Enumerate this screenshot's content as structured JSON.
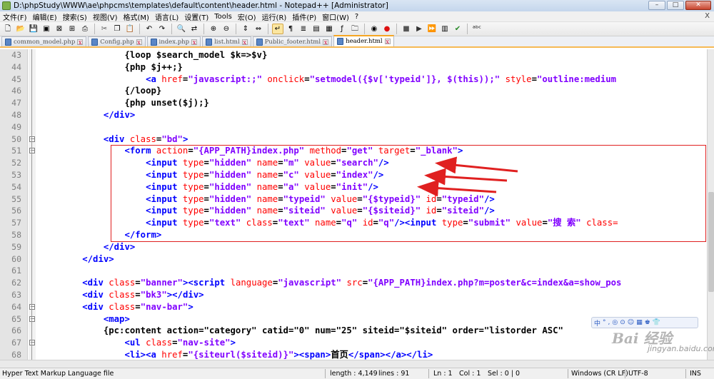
{
  "window": {
    "title": "D:\\phpStudy\\WWW\\ae\\phpcms\\templates\\default\\content\\header.html - Notepad++ [Administrator]",
    "minimize": "–",
    "maximize": "□",
    "close": "✕"
  },
  "menu": [
    "文件(F)",
    "编辑(E)",
    "搜索(S)",
    "视图(V)",
    "格式(M)",
    "语言(L)",
    "设置(T)",
    "Tools",
    "宏(O)",
    "运行(R)",
    "插件(P)",
    "窗口(W)",
    "?"
  ],
  "menu_close": "X",
  "tabs": [
    {
      "label": "common_model.php"
    },
    {
      "label": "Config.php"
    },
    {
      "label": "index.php"
    },
    {
      "label": "list.html"
    },
    {
      "label": "Public_footer.html"
    },
    {
      "label": "header.html",
      "active": true
    }
  ],
  "editor": {
    "lines": [
      {
        "n": "43",
        "tokens": [
          [
            "d",
            "                {loop $search_model $k=>$v}"
          ]
        ]
      },
      {
        "n": "44",
        "tokens": [
          [
            "d",
            "                {php $j++;}"
          ]
        ]
      },
      {
        "n": "45",
        "tokens": [
          [
            "d",
            "                    "
          ],
          [
            "tag",
            "<a "
          ],
          [
            "attr",
            "href"
          ],
          [
            "d",
            "="
          ],
          [
            "val",
            "\"javascript:;\""
          ],
          [
            "d",
            " "
          ],
          [
            "attr",
            "onclick"
          ],
          [
            "d",
            "="
          ],
          [
            "val",
            "\"setmodel({$v['typeid']}, $(this));\""
          ],
          [
            "d",
            " "
          ],
          [
            "attr",
            "style"
          ],
          [
            "d",
            "="
          ],
          [
            "val",
            "\"outline:medium"
          ]
        ]
      },
      {
        "n": "46",
        "tokens": [
          [
            "d",
            "                {/loop}"
          ]
        ]
      },
      {
        "n": "47",
        "tokens": [
          [
            "d",
            "                {php unset($j);}"
          ]
        ]
      },
      {
        "n": "48",
        "tokens": [
          [
            "d",
            "            "
          ],
          [
            "tag",
            "</div>"
          ]
        ]
      },
      {
        "n": "49",
        "tokens": [
          [
            "d",
            ""
          ]
        ]
      },
      {
        "n": "50",
        "tokens": [
          [
            "d",
            "            "
          ],
          [
            "tag",
            "<div "
          ],
          [
            "attr",
            "class"
          ],
          [
            "d",
            "="
          ],
          [
            "val",
            "\"bd\""
          ],
          [
            "tag",
            ">"
          ]
        ]
      },
      {
        "n": "51",
        "tokens": [
          [
            "d",
            "                "
          ],
          [
            "tag",
            "<form "
          ],
          [
            "attr",
            "action"
          ],
          [
            "d",
            "="
          ],
          [
            "val",
            "\"{APP_PATH}index.php\""
          ],
          [
            "d",
            " "
          ],
          [
            "attr",
            "method"
          ],
          [
            "d",
            "="
          ],
          [
            "val",
            "\"get\""
          ],
          [
            "d",
            " "
          ],
          [
            "attr",
            "target"
          ],
          [
            "d",
            "="
          ],
          [
            "val",
            "\"_blank\""
          ],
          [
            "tag",
            ">"
          ]
        ]
      },
      {
        "n": "52",
        "tokens": [
          [
            "d",
            "                    "
          ],
          [
            "tag",
            "<input "
          ],
          [
            "attr",
            "type"
          ],
          [
            "d",
            "="
          ],
          [
            "val",
            "\"hidden\""
          ],
          [
            "d",
            " "
          ],
          [
            "attr",
            "name"
          ],
          [
            "d",
            "="
          ],
          [
            "val",
            "\"m\""
          ],
          [
            "d",
            " "
          ],
          [
            "attr",
            "value"
          ],
          [
            "d",
            "="
          ],
          [
            "val",
            "\"search\""
          ],
          [
            "tag",
            "/>"
          ]
        ]
      },
      {
        "n": "53",
        "tokens": [
          [
            "d",
            "                    "
          ],
          [
            "tag",
            "<input "
          ],
          [
            "attr",
            "type"
          ],
          [
            "d",
            "="
          ],
          [
            "val",
            "\"hidden\""
          ],
          [
            "d",
            " "
          ],
          [
            "attr",
            "name"
          ],
          [
            "d",
            "="
          ],
          [
            "val",
            "\"c\""
          ],
          [
            "d",
            " "
          ],
          [
            "attr",
            "value"
          ],
          [
            "d",
            "="
          ],
          [
            "val",
            "\"index\""
          ],
          [
            "tag",
            "/>"
          ]
        ]
      },
      {
        "n": "54",
        "tokens": [
          [
            "d",
            "                    "
          ],
          [
            "tag",
            "<input "
          ],
          [
            "attr",
            "type"
          ],
          [
            "d",
            "="
          ],
          [
            "val",
            "\"hidden\""
          ],
          [
            "d",
            " "
          ],
          [
            "attr",
            "name"
          ],
          [
            "d",
            "="
          ],
          [
            "val",
            "\"a\""
          ],
          [
            "d",
            " "
          ],
          [
            "attr",
            "value"
          ],
          [
            "d",
            "="
          ],
          [
            "val",
            "\"init\""
          ],
          [
            "tag",
            "/>"
          ]
        ]
      },
      {
        "n": "55",
        "tokens": [
          [
            "d",
            "                    "
          ],
          [
            "tag",
            "<input "
          ],
          [
            "attr",
            "type"
          ],
          [
            "d",
            "="
          ],
          [
            "val",
            "\"hidden\""
          ],
          [
            "d",
            " "
          ],
          [
            "attr",
            "name"
          ],
          [
            "d",
            "="
          ],
          [
            "val",
            "\"typeid\""
          ],
          [
            "d",
            " "
          ],
          [
            "attr",
            "value"
          ],
          [
            "d",
            "="
          ],
          [
            "val",
            "\"{$typeid}\""
          ],
          [
            "d",
            " "
          ],
          [
            "attr",
            "id"
          ],
          [
            "d",
            "="
          ],
          [
            "val",
            "\"typeid\""
          ],
          [
            "tag",
            "/>"
          ]
        ]
      },
      {
        "n": "56",
        "tokens": [
          [
            "d",
            "                    "
          ],
          [
            "tag",
            "<input "
          ],
          [
            "attr",
            "type"
          ],
          [
            "d",
            "="
          ],
          [
            "val",
            "\"hidden\""
          ],
          [
            "d",
            " "
          ],
          [
            "attr",
            "name"
          ],
          [
            "d",
            "="
          ],
          [
            "val",
            "\"siteid\""
          ],
          [
            "d",
            " "
          ],
          [
            "attr",
            "value"
          ],
          [
            "d",
            "="
          ],
          [
            "val",
            "\"{$siteid}\""
          ],
          [
            "d",
            " "
          ],
          [
            "attr",
            "id"
          ],
          [
            "d",
            "="
          ],
          [
            "val",
            "\"siteid\""
          ],
          [
            "tag",
            "/>"
          ]
        ]
      },
      {
        "n": "57",
        "tokens": [
          [
            "d",
            "                    "
          ],
          [
            "tag",
            "<input "
          ],
          [
            "attr",
            "type"
          ],
          [
            "d",
            "="
          ],
          [
            "val",
            "\"text\""
          ],
          [
            "d",
            " "
          ],
          [
            "attr",
            "class"
          ],
          [
            "d",
            "="
          ],
          [
            "val",
            "\"text\""
          ],
          [
            "d",
            " "
          ],
          [
            "attr",
            "name"
          ],
          [
            "d",
            "="
          ],
          [
            "val",
            "\"q\""
          ],
          [
            "d",
            " "
          ],
          [
            "attr",
            "id"
          ],
          [
            "d",
            "="
          ],
          [
            "val",
            "\"q\""
          ],
          [
            "tag",
            "/><input "
          ],
          [
            "attr",
            "type"
          ],
          [
            "d",
            "="
          ],
          [
            "val",
            "\"submit\""
          ],
          [
            "d",
            " "
          ],
          [
            "attr",
            "value"
          ],
          [
            "d",
            "="
          ],
          [
            "val",
            "\"搜 索\""
          ],
          [
            "d",
            " "
          ],
          [
            "attr",
            "class="
          ]
        ]
      },
      {
        "n": "58",
        "tokens": [
          [
            "d",
            "                "
          ],
          [
            "tag",
            "</form>"
          ]
        ]
      },
      {
        "n": "59",
        "tokens": [
          [
            "d",
            "            "
          ],
          [
            "tag",
            "</div>"
          ]
        ]
      },
      {
        "n": "60",
        "tokens": [
          [
            "d",
            "        "
          ],
          [
            "tag",
            "</div>"
          ]
        ]
      },
      {
        "n": "61",
        "tokens": [
          [
            "d",
            ""
          ]
        ]
      },
      {
        "n": "62",
        "tokens": [
          [
            "d",
            "        "
          ],
          [
            "tag",
            "<div "
          ],
          [
            "attr",
            "class"
          ],
          [
            "d",
            "="
          ],
          [
            "val",
            "\"banner\""
          ],
          [
            "tag",
            "><script "
          ],
          [
            "attr",
            "language"
          ],
          [
            "d",
            "="
          ],
          [
            "val",
            "\"javascript\""
          ],
          [
            "d",
            " "
          ],
          [
            "attr",
            "src"
          ],
          [
            "d",
            "="
          ],
          [
            "val",
            "\"{APP_PATH}index.php?m=poster&c=index&a=show_pos"
          ]
        ]
      },
      {
        "n": "63",
        "tokens": [
          [
            "d",
            "        "
          ],
          [
            "tag",
            "<div "
          ],
          [
            "attr",
            "class"
          ],
          [
            "d",
            "="
          ],
          [
            "val",
            "\"bk3\""
          ],
          [
            "tag",
            "></div>"
          ]
        ]
      },
      {
        "n": "64",
        "tokens": [
          [
            "d",
            "        "
          ],
          [
            "tag",
            "<div "
          ],
          [
            "attr",
            "class"
          ],
          [
            "d",
            "="
          ],
          [
            "val",
            "\"nav-bar\""
          ],
          [
            "tag",
            ">"
          ]
        ]
      },
      {
        "n": "65",
        "tokens": [
          [
            "d",
            "            "
          ],
          [
            "tag",
            "<map>"
          ]
        ]
      },
      {
        "n": "66",
        "tokens": [
          [
            "d",
            "            {pc:content action=\"category\" catid=\"0\" num=\"25\" siteid=\"$siteid\" order=\"listorder ASC\""
          ]
        ]
      },
      {
        "n": "67",
        "tokens": [
          [
            "d",
            "                "
          ],
          [
            "tag",
            "<ul "
          ],
          [
            "attr",
            "class"
          ],
          [
            "d",
            "="
          ],
          [
            "val",
            "\"nav-site\""
          ],
          [
            "tag",
            ">"
          ]
        ]
      },
      {
        "n": "68",
        "tokens": [
          [
            "d",
            "                "
          ],
          [
            "tag",
            "<li><a "
          ],
          [
            "attr",
            "href"
          ],
          [
            "d",
            "="
          ],
          [
            "val",
            "\"{siteurl($siteid)}\""
          ],
          [
            "tag",
            "><span>"
          ],
          [
            "d",
            "首页"
          ],
          [
            "tag",
            "</span></a></li>"
          ]
        ]
      }
    ]
  },
  "watermark": {
    "logo": "Bai 经验",
    "url": "jingyan.baidu.com",
    "toolbar": [
      "中",
      "°",
      ",",
      "◎",
      "⊙",
      "☺",
      "▦",
      "♚",
      "👕"
    ]
  },
  "status": {
    "filetype": "Hyper Text Markup Language file",
    "length": "length : 4,149",
    "lines": "lines : 91",
    "ln": "Ln : 1",
    "col": "Col : 1",
    "sel": "Sel : 0 | 0",
    "eol": "Windows (CR LF)",
    "encoding": "UTF-8",
    "mode": "INS"
  },
  "colors": {
    "tag": "#0000ff",
    "attr": "#ff0000",
    "value": "#8000ff",
    "highlight_box": "#e02020",
    "arrow": "#e02020",
    "active_tab_accent": "#f6a623"
  },
  "toolbar_icons": [
    "new-file-icon",
    "open-file-icon",
    "save-icon",
    "save-all-icon",
    "close-icon",
    "close-all-icon",
    "print-icon",
    "cut-icon",
    "copy-icon",
    "paste-icon",
    "undo-icon",
    "redo-icon",
    "find-icon",
    "replace-icon",
    "zoom-in-icon",
    "zoom-out-icon",
    "sync-v-icon",
    "sync-h-icon",
    "word-wrap-icon",
    "show-all-chars-icon",
    "indent-guide-icon",
    "user-lang-icon",
    "doc-map-icon",
    "function-list-icon",
    "folder-workspace-icon",
    "monitor-icon",
    "record-macro-icon",
    "stop-record-icon",
    "play-macro-icon",
    "run-macro-multiple-icon",
    "save-macro-icon",
    "spellcheck-icon",
    "abc-icon"
  ]
}
